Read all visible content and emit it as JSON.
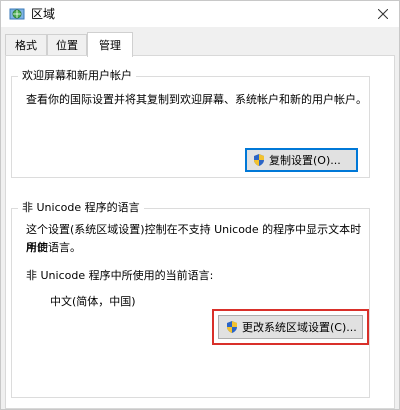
{
  "window": {
    "title": "区域"
  },
  "tabs": [
    {
      "label": "格式",
      "active": false
    },
    {
      "label": "位置",
      "active": false
    },
    {
      "label": "管理",
      "active": true
    }
  ],
  "welcome_group": {
    "legend": "欢迎屏幕和新用户帐户",
    "description": "查看你的国际设置并将其复制到欢迎屏幕、系统帐户和新的用户帐户。",
    "copy_button": "复制设置(O)..."
  },
  "unicode_group": {
    "legend": "非 Unicode 程序的语言",
    "description_line1": "这个设置(系统区域设置)控制在不支持 Unicode 的程序中显示文本时所使",
    "description_line2": "用的语言。",
    "current_label": "非 Unicode 程序中所使用的当前语言:",
    "current_value": "中文(简体，中国)",
    "change_button": "更改系统区域设置(C)..."
  },
  "colors": {
    "highlight": "#d9302a",
    "focus_border": "#0078d7"
  }
}
